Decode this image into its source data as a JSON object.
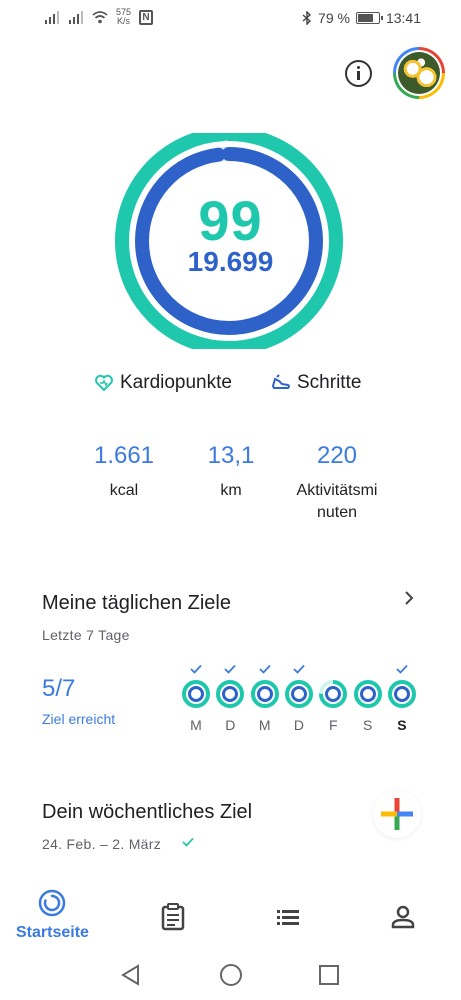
{
  "status_bar": {
    "net_speed_value": "575",
    "net_speed_unit": "K/s",
    "nfc_label": "N",
    "battery_percent": "79 %",
    "battery_level": 0.79,
    "time": "13:41"
  },
  "header": {
    "info_icon": "info-icon",
    "avatar_icon": "profile-avatar"
  },
  "summary": {
    "heart_points": "99",
    "steps": "19.699",
    "heart_points_fraction": 0.99,
    "steps_fraction": 0.98,
    "colors": {
      "heart": "#1fc8ad",
      "steps": "#2f62c9"
    }
  },
  "legend": {
    "heart_label": "Kardiopunkte",
    "steps_label": "Schritte"
  },
  "stats": [
    {
      "value": "1.661",
      "label": "kcal"
    },
    {
      "value": "13,1",
      "label": "km"
    },
    {
      "value": "220",
      "label": "Aktivitätsmi nuten"
    }
  ],
  "daily_goals": {
    "title": "Meine täglichen Ziele",
    "subtitle": "Letzte 7 Tage",
    "count": "5/7",
    "achieved_label": "Ziel erreicht",
    "days": [
      {
        "label": "M",
        "checked": true,
        "progress": 1.0
      },
      {
        "label": "D",
        "checked": true,
        "progress": 1.0
      },
      {
        "label": "M",
        "checked": true,
        "progress": 1.0
      },
      {
        "label": "D",
        "checked": true,
        "progress": 1.0
      },
      {
        "label": "F",
        "checked": false,
        "progress": 0.75
      },
      {
        "label": "S",
        "checked": false,
        "progress": 1.0
      },
      {
        "label": "S",
        "checked": true,
        "progress": 1.0
      }
    ]
  },
  "weekly_goal": {
    "title": "Dein wöchentliches Ziel",
    "date_range": "24. Feb. – 2. März"
  },
  "bottom_nav": {
    "home_label": "Startseite"
  }
}
